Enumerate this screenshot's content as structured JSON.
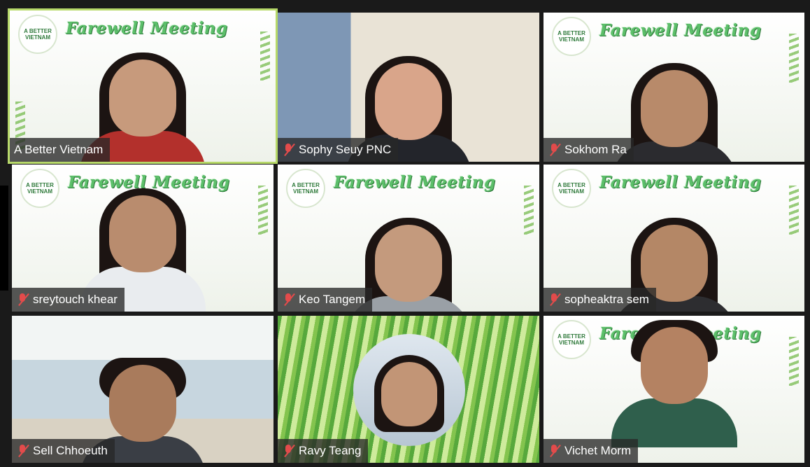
{
  "meeting": {
    "banner_title": "Farewell Meeting",
    "logo_text": "A BETTER VIETNAM"
  },
  "participants": [
    {
      "name": "A Better Vietnam",
      "muted": false,
      "active": true,
      "background": "banner"
    },
    {
      "name": "Sophy Seuy PNC",
      "muted": true,
      "active": false,
      "background": "room"
    },
    {
      "name": "Sokhom Ra",
      "muted": true,
      "active": false,
      "background": "banner"
    },
    {
      "name": "sreytouch khear",
      "muted": true,
      "active": false,
      "background": "banner"
    },
    {
      "name": "Keo Tangem",
      "muted": true,
      "active": false,
      "background": "banner"
    },
    {
      "name": "sopheaktra sem",
      "muted": true,
      "active": false,
      "background": "banner"
    },
    {
      "name": "Sell Chhoeuth",
      "muted": true,
      "active": false,
      "background": "outdoor"
    },
    {
      "name": "Ravy Teang",
      "muted": true,
      "active": false,
      "background": "grass"
    },
    {
      "name": "Vichet Morm",
      "muted": true,
      "active": false,
      "background": "banner"
    }
  ],
  "colors": {
    "active_border": "#b7d96a",
    "muted_icon": "#e34b4b",
    "banner_text": "#5cbf6a"
  }
}
